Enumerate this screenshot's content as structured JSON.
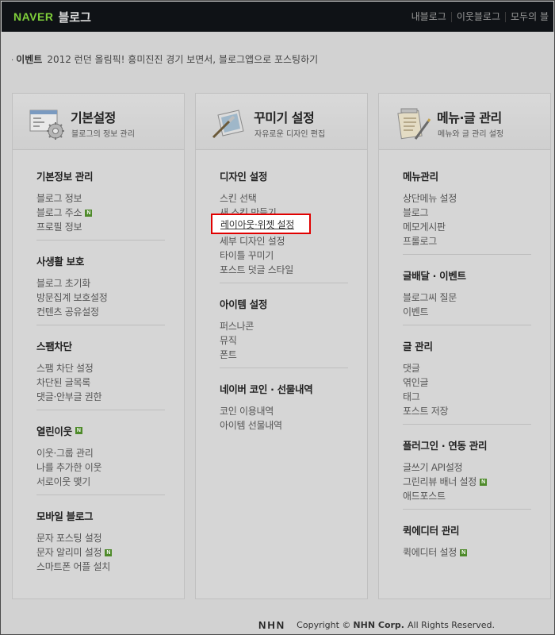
{
  "header": {
    "logo_naver": "NAVER",
    "logo_blog": "블로그",
    "nav": [
      "내블로그",
      "이웃블로그",
      "모두의 블"
    ]
  },
  "notice": {
    "tag": "이벤트",
    "text": "2012 런던 올림픽! 흥미진진 경기 보면서, 블로그앱으로 포스팅하기"
  },
  "panels": [
    {
      "title": "기본설정",
      "subtitle": "블로그의 정보 관리",
      "groups": [
        {
          "title": "기본정보 관리",
          "items": [
            "블로그 정보",
            "블로그 주소",
            "프로필 정보"
          ]
        },
        {
          "title": "사생활 보호",
          "items": [
            "블로그 초기화",
            "방문집계 보호설정",
            "컨텐츠 공유설정"
          ]
        },
        {
          "title": "스팸차단",
          "items": [
            "스팸 차단 설정",
            "차단된 글목록",
            "댓글·안부글 권한"
          ]
        },
        {
          "title": "열린이웃",
          "items": [
            "이웃·그룹 관리",
            "나를 추가한 이웃",
            "서로이웃 맺기"
          ]
        },
        {
          "title": "모바일 블로그",
          "items": [
            "문자 포스팅 설정",
            "문자 알리미 설정",
            "스마트폰 어플 설치"
          ]
        }
      ]
    },
    {
      "title": "꾸미기 설정",
      "subtitle": "자유로운 디자인 편집",
      "groups": [
        {
          "title": "디자인 설정",
          "items": [
            "스킨 선택",
            "새 스킨 만들기",
            "레이아웃·위젯 설정",
            "세부 디자인 설정",
            "타이틀 꾸미기",
            "포스트 덧글 스타일"
          ]
        },
        {
          "title": "아이템 설정",
          "items": [
            "퍼스나콘",
            "뮤직",
            "폰트"
          ]
        },
        {
          "title": "네이버 코인 · 선물내역",
          "items": [
            "코인 이용내역",
            "아이템 선물내역"
          ]
        }
      ]
    },
    {
      "title": "메뉴·글 관리",
      "subtitle": "메뉴와 글 관리 설정",
      "groups": [
        {
          "title": "메뉴관리",
          "items": [
            "상단메뉴 설정",
            "블로그",
            "메모게시판",
            "프롤로그"
          ]
        },
        {
          "title": "글배달 · 이벤트",
          "items": [
            "블로그씨 질문",
            "이벤트"
          ]
        },
        {
          "title": "글 관리",
          "items": [
            "댓글",
            "엮인글",
            "태그",
            "포스트 저장"
          ]
        },
        {
          "title": "플러그인 · 연동 관리",
          "items": [
            "글쓰기 API설정",
            "그린리뷰 배너 설정",
            "애드포스트"
          ]
        },
        {
          "title": "퀵에디터 관리",
          "items": [
            "퀵에디터 설정"
          ]
        }
      ]
    }
  ],
  "new_badge": "N",
  "footer": {
    "logo": "NHN",
    "copyright_prefix": "Copyright ©",
    "company": "NHN Corp.",
    "rights": "All Rights Reserved."
  }
}
